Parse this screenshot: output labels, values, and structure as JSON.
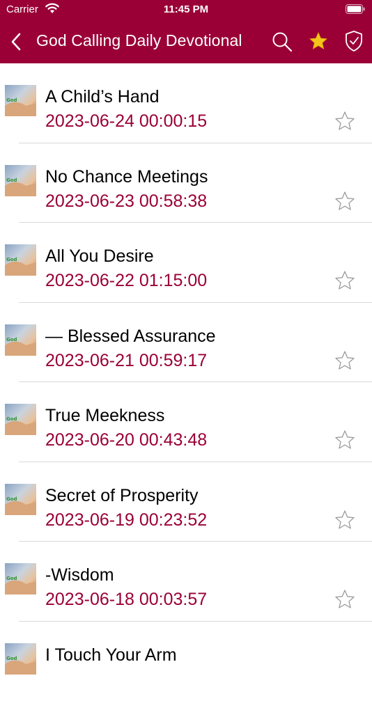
{
  "status_bar": {
    "carrier": "Carrier",
    "time": "11:45 PM",
    "wifi_icon": "wifi-icon",
    "battery_icon": "battery-icon"
  },
  "nav": {
    "title": "God Calling Daily Devotional",
    "back_icon": "chevron-left-icon",
    "search_icon": "search-icon",
    "favorites_icon": "star-filled-icon",
    "shield_icon": "shield-check-icon"
  },
  "colors": {
    "brand": "#9a0036",
    "date_text": "#9a0036",
    "star_fill": "#f3c41c",
    "divider": "#d9d9d9"
  },
  "items": [
    {
      "title": "A Child’s Hand",
      "date": "2023-06-24 00:00:15"
    },
    {
      "title": "No Chance Meetings",
      "date": "2023-06-23 00:58:38"
    },
    {
      "title": "All You Desire",
      "date": "2023-06-22 01:15:00"
    },
    {
      "title": "— Blessed Assurance",
      "date": "2023-06-21 00:59:17"
    },
    {
      "title": "True Meekness",
      "date": "2023-06-20 00:43:48"
    },
    {
      "title": "Secret of Prosperity",
      "date": "2023-06-19 00:23:52"
    },
    {
      "title": "-Wisdom",
      "date": "2023-06-18 00:03:57"
    },
    {
      "title": "I Touch Your Arm",
      "date": ""
    }
  ]
}
